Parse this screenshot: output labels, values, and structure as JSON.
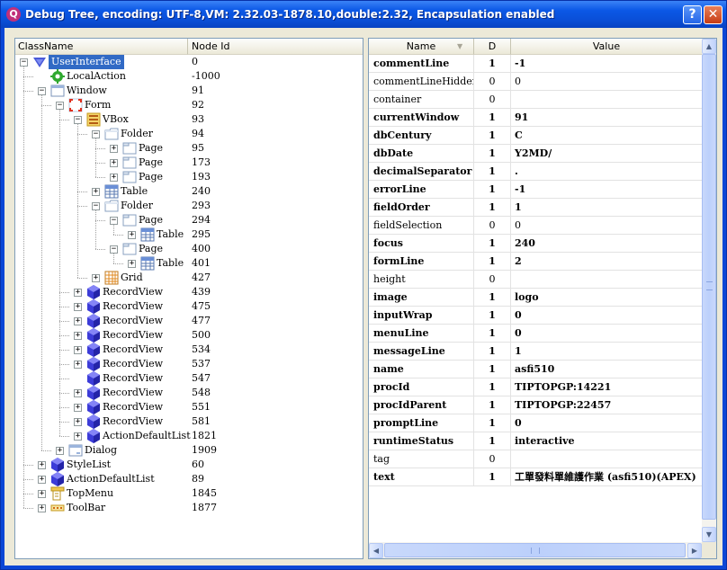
{
  "window": {
    "title": "Debug Tree, encoding: UTF-8,VM: 2.32.03-1878.10,double:2.32, Encapsulation enabled",
    "help_label": "?",
    "close_label": "✕"
  },
  "tree": {
    "columns": {
      "classname": "ClassName",
      "nodeid": "Node Id"
    },
    "nodes": [
      {
        "label": "UserInterface",
        "id": "0",
        "icon": "user-interface-icon"
      },
      {
        "label": "LocalAction",
        "id": "-1000",
        "icon": "gear-icon"
      },
      {
        "label": "Window",
        "id": "91",
        "icon": "window-icon"
      },
      {
        "label": "Form",
        "id": "92",
        "icon": "form-icon"
      },
      {
        "label": "VBox",
        "id": "93",
        "icon": "vbox-icon"
      },
      {
        "label": "Folder",
        "id": "94",
        "icon": "folder-icon"
      },
      {
        "label": "Page",
        "id": "95",
        "icon": "page-icon"
      },
      {
        "label": "Page",
        "id": "173",
        "icon": "page-icon"
      },
      {
        "label": "Page",
        "id": "193",
        "icon": "page-icon"
      },
      {
        "label": "Table",
        "id": "240",
        "icon": "table-icon"
      },
      {
        "label": "Folder",
        "id": "293",
        "icon": "folder-icon"
      },
      {
        "label": "Page",
        "id": "294",
        "icon": "page-icon"
      },
      {
        "label": "Table",
        "id": "295",
        "icon": "table-icon"
      },
      {
        "label": "Page",
        "id": "400",
        "icon": "page-icon"
      },
      {
        "label": "Table",
        "id": "401",
        "icon": "table-icon"
      },
      {
        "label": "Grid",
        "id": "427",
        "icon": "grid-icon"
      },
      {
        "label": "RecordView",
        "id": "439",
        "icon": "cube-icon"
      },
      {
        "label": "RecordView",
        "id": "475",
        "icon": "cube-icon"
      },
      {
        "label": "RecordView",
        "id": "477",
        "icon": "cube-icon"
      },
      {
        "label": "RecordView",
        "id": "500",
        "icon": "cube-icon"
      },
      {
        "label": "RecordView",
        "id": "534",
        "icon": "cube-icon"
      },
      {
        "label": "RecordView",
        "id": "537",
        "icon": "cube-icon"
      },
      {
        "label": "RecordView",
        "id": "547",
        "icon": "cube-icon"
      },
      {
        "label": "RecordView",
        "id": "548",
        "icon": "cube-icon"
      },
      {
        "label": "RecordView",
        "id": "551",
        "icon": "cube-icon"
      },
      {
        "label": "RecordView",
        "id": "581",
        "icon": "cube-icon"
      },
      {
        "label": "ActionDefaultList",
        "id": "1821",
        "icon": "cube-icon"
      },
      {
        "label": "Dialog",
        "id": "1909",
        "icon": "dialog-icon"
      },
      {
        "label": "StyleList",
        "id": "60",
        "icon": "cube-icon"
      },
      {
        "label": "ActionDefaultList",
        "id": "89",
        "icon": "cube-icon"
      },
      {
        "label": "TopMenu",
        "id": "1845",
        "icon": "top-menu-icon"
      },
      {
        "label": "ToolBar",
        "id": "1877",
        "icon": "toolbar-icon"
      }
    ]
  },
  "props": {
    "columns": {
      "name": "Name",
      "d": "D",
      "value": "Value"
    },
    "rows": [
      {
        "name": "commentLine",
        "d": "1",
        "value": "-1"
      },
      {
        "name": "commentLineHidden",
        "d": "0",
        "value": "0"
      },
      {
        "name": "container",
        "d": "0",
        "value": ""
      },
      {
        "name": "currentWindow",
        "d": "1",
        "value": "91"
      },
      {
        "name": "dbCentury",
        "d": "1",
        "value": "C"
      },
      {
        "name": "dbDate",
        "d": "1",
        "value": "Y2MD/"
      },
      {
        "name": "decimalSeparator",
        "d": "1",
        "value": "."
      },
      {
        "name": "errorLine",
        "d": "1",
        "value": "-1"
      },
      {
        "name": "fieldOrder",
        "d": "1",
        "value": "1"
      },
      {
        "name": "fieldSelection",
        "d": "0",
        "value": "0"
      },
      {
        "name": "focus",
        "d": "1",
        "value": "240"
      },
      {
        "name": "formLine",
        "d": "1",
        "value": "2"
      },
      {
        "name": "height",
        "d": "0",
        "value": ""
      },
      {
        "name": "image",
        "d": "1",
        "value": "logo"
      },
      {
        "name": "inputWrap",
        "d": "1",
        "value": "0"
      },
      {
        "name": "menuLine",
        "d": "1",
        "value": "0"
      },
      {
        "name": "messageLine",
        "d": "1",
        "value": "1"
      },
      {
        "name": "name",
        "d": "1",
        "value": "asfi510"
      },
      {
        "name": "procId",
        "d": "1",
        "value": "TIPTOPGP:14221"
      },
      {
        "name": "procIdParent",
        "d": "1",
        "value": "TIPTOPGP:22457"
      },
      {
        "name": "promptLine",
        "d": "1",
        "value": "0"
      },
      {
        "name": "runtimeStatus",
        "d": "1",
        "value": "interactive"
      },
      {
        "name": "tag",
        "d": "0",
        "value": ""
      },
      {
        "name": "text",
        "d": "1",
        "value": "工單發料單維護作業 (asfi510)(APEX)"
      }
    ]
  }
}
